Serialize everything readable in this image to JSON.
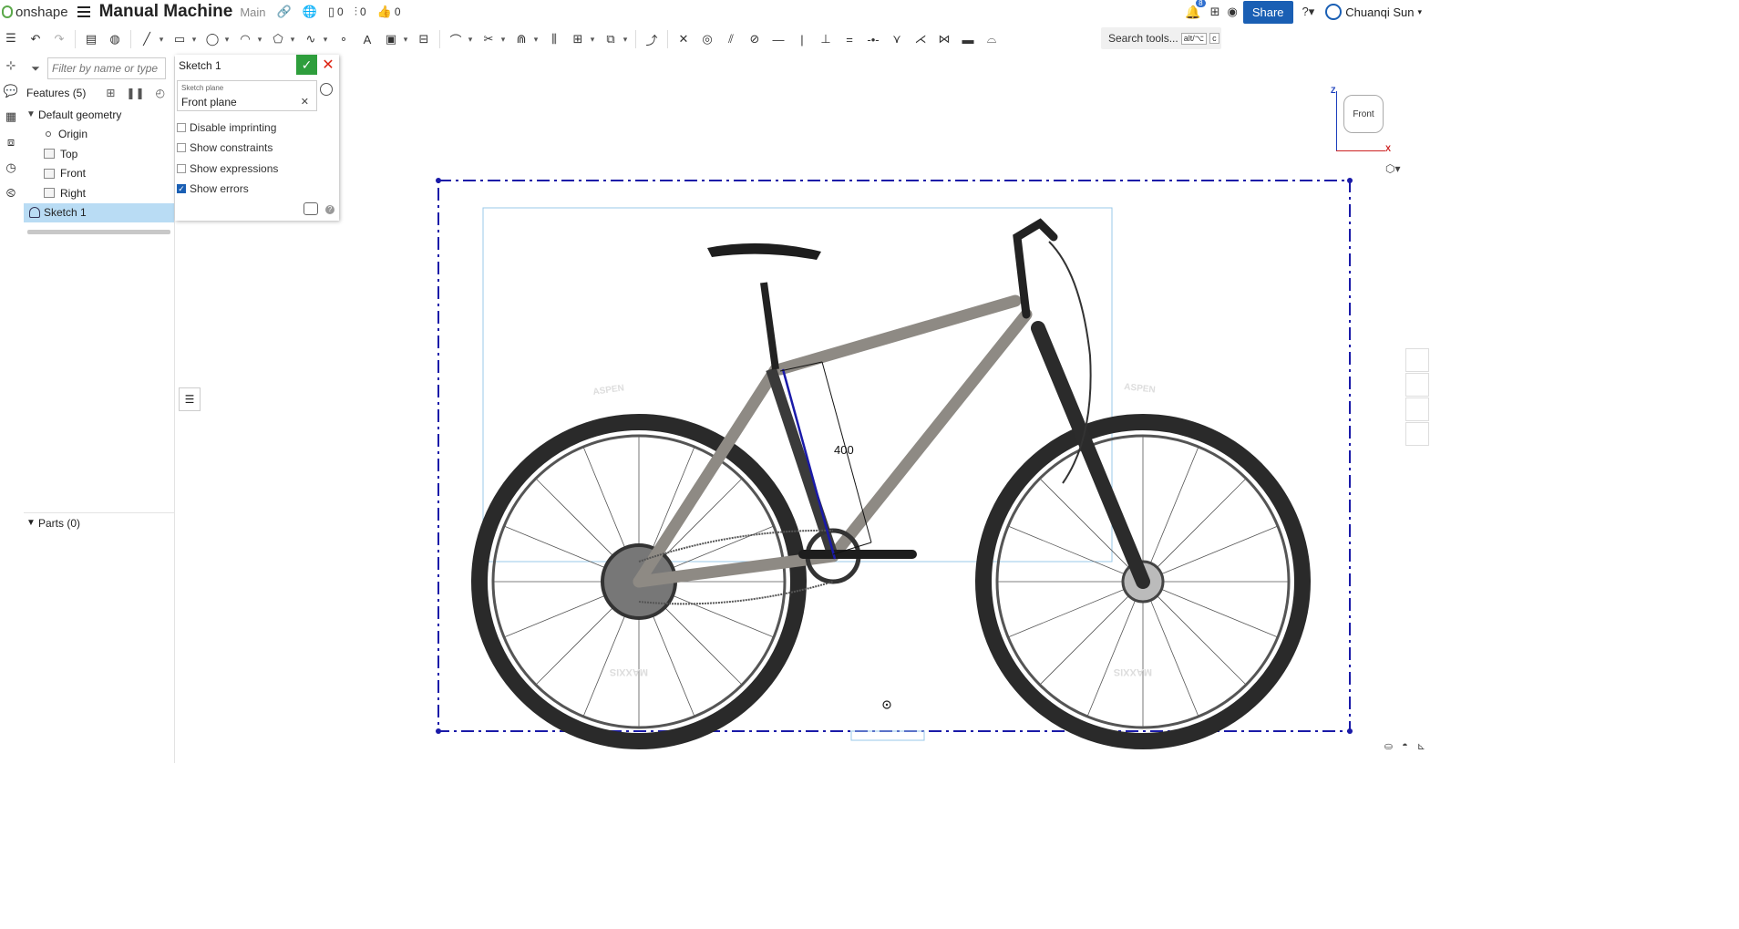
{
  "app": {
    "logo_text": "onshape",
    "doc_title": "Manual Machine",
    "branch": "Main"
  },
  "topbar": {
    "versions_count": "0",
    "branches_count": "0",
    "likes_count": "0",
    "notifications_badge": "8",
    "share_label": "Share",
    "user_name": "Chuanqi Sun"
  },
  "toolbar": {
    "search_label": "Search tools...",
    "search_shortcut_1": "alt/⌥",
    "search_shortcut_2": "c"
  },
  "features": {
    "filter_placeholder": "Filter by name or type",
    "header": "Features (5)",
    "default_geometry": "Default geometry",
    "items": [
      {
        "label": "Origin"
      },
      {
        "label": "Top"
      },
      {
        "label": "Front"
      },
      {
        "label": "Right"
      },
      {
        "label": "Sketch 1"
      }
    ],
    "parts_header": "Parts (0)"
  },
  "sketch_dialog": {
    "title": "Sketch 1",
    "plane_label": "Sketch plane",
    "plane_value": "Front plane",
    "options": [
      {
        "label": "Disable imprinting",
        "checked": false
      },
      {
        "label": "Show constraints",
        "checked": false
      },
      {
        "label": "Show expressions",
        "checked": false
      },
      {
        "label": "Show errors",
        "checked": true
      }
    ]
  },
  "viewport": {
    "view_label": "Front",
    "axis_z": "Z",
    "axis_x": "X",
    "dimension_value": "400",
    "sketch_line_color": "#1a1aa8",
    "image_box_color": "#9ac8e8",
    "image_description_labels": {
      "tire_brand": "MAXXIS",
      "tire_model": "ASPEN"
    }
  },
  "colors": {
    "accent": "#1a5fb4",
    "ok": "#2e9e3c",
    "cancel": "#dd2211",
    "selection": "#b9dcf4"
  }
}
